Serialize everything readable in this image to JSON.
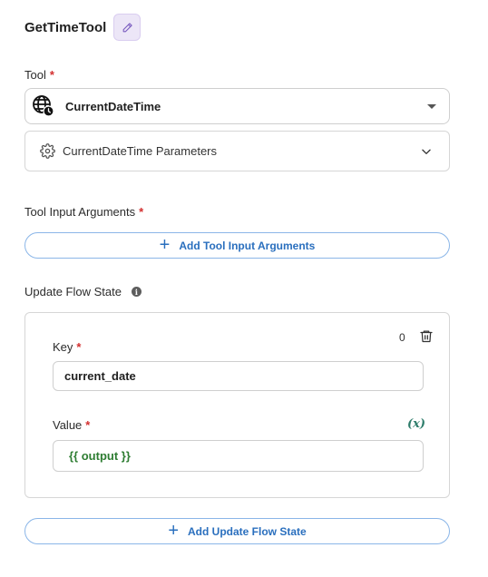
{
  "node": {
    "title": "GetTimeTool"
  },
  "tool": {
    "label": "Tool",
    "required_mark": "*",
    "selected": "CurrentDateTime",
    "selected_icon": "globe-clock-icon",
    "params_label": "CurrentDateTime Parameters"
  },
  "tool_input": {
    "label": "Tool Input Arguments",
    "required_mark": "*",
    "add_label": "Add Tool Input Arguments"
  },
  "flow_state": {
    "label": "Update Flow State",
    "info_glyph": "i",
    "items": [
      {
        "index": "0",
        "key_label": "Key",
        "key_required": "*",
        "key_value": "current_date",
        "value_label": "Value",
        "value_required": "*",
        "variable_button": "(x)",
        "value_value": "{{ output }}"
      }
    ],
    "add_label": "Add Update Flow State"
  },
  "colors": {
    "accent_blue": "#2a6fbe",
    "required_red": "#d32f2f",
    "output_green": "#2e7d32",
    "edit_bg": "#ece6f7"
  }
}
